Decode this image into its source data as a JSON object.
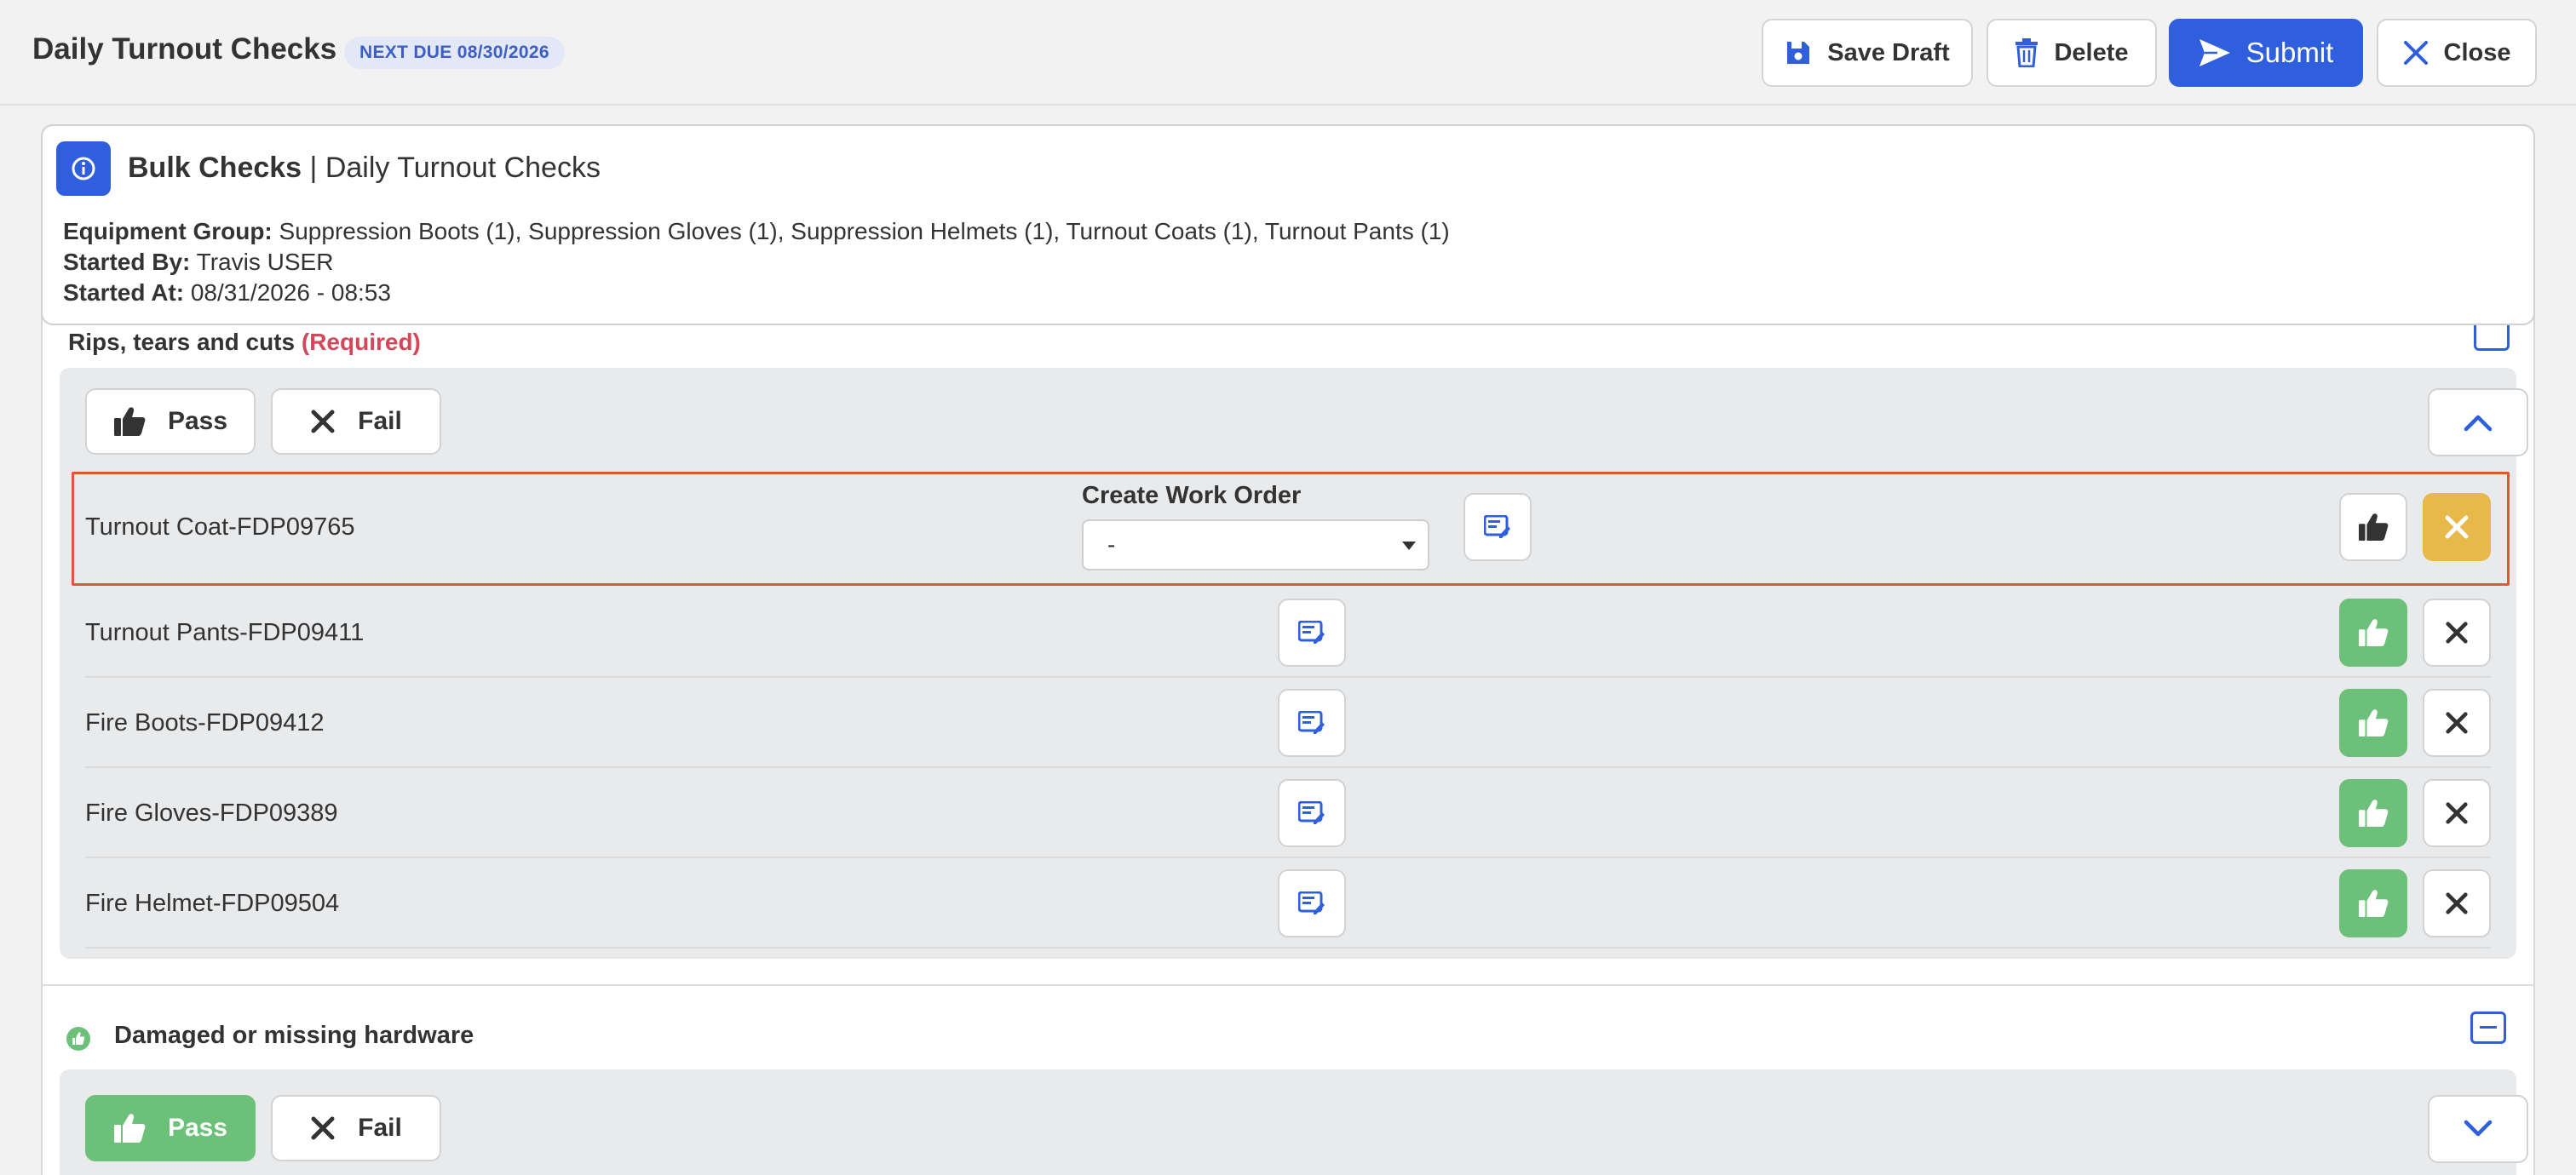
{
  "header": {
    "title": "Daily Turnout Checks",
    "due_badge": "NEXT DUE 08/30/2026",
    "buttons": {
      "save_draft": "Save Draft",
      "delete": "Delete",
      "submit": "Submit",
      "close": "Close"
    }
  },
  "info": {
    "heading_bold": "Bulk Checks",
    "heading_rest": "| Daily Turnout Checks",
    "equipment_group_label": "Equipment Group:",
    "equipment_group_value": "Suppression Boots (1), Suppression Gloves (1), Suppression Helmets (1), Turnout Coats (1), Turnout Pants (1)",
    "started_by_label": "Started By:",
    "started_by_value": "Travis USER",
    "started_at_label": "Started At:",
    "started_at_value": "08/31/2026 - 08:53"
  },
  "section1": {
    "title": "Rips, tears and cuts",
    "required": "(Required)",
    "pass_label": "Pass",
    "fail_label": "Fail",
    "work_order_label": "Create Work Order",
    "work_order_value": "-",
    "items": [
      {
        "name": "Turnout Coat-FDP09765",
        "status": "fail",
        "selected": true
      },
      {
        "name": "Turnout Pants-FDP09411",
        "status": "pass"
      },
      {
        "name": "Fire Boots-FDP09412",
        "status": "pass"
      },
      {
        "name": "Fire Gloves-FDP09389",
        "status": "pass"
      },
      {
        "name": "Fire Helmet-FDP09504",
        "status": "pass"
      }
    ]
  },
  "section2": {
    "title": "Damaged or missing hardware",
    "pass_label": "Pass",
    "fail_label": "Fail"
  },
  "colors": {
    "primary": "#2f5fdc",
    "pass_green": "#6cc07a",
    "fail_yellow": "#e7b84a",
    "required_red": "#d0485a",
    "highlight_border": "#e2553a"
  }
}
